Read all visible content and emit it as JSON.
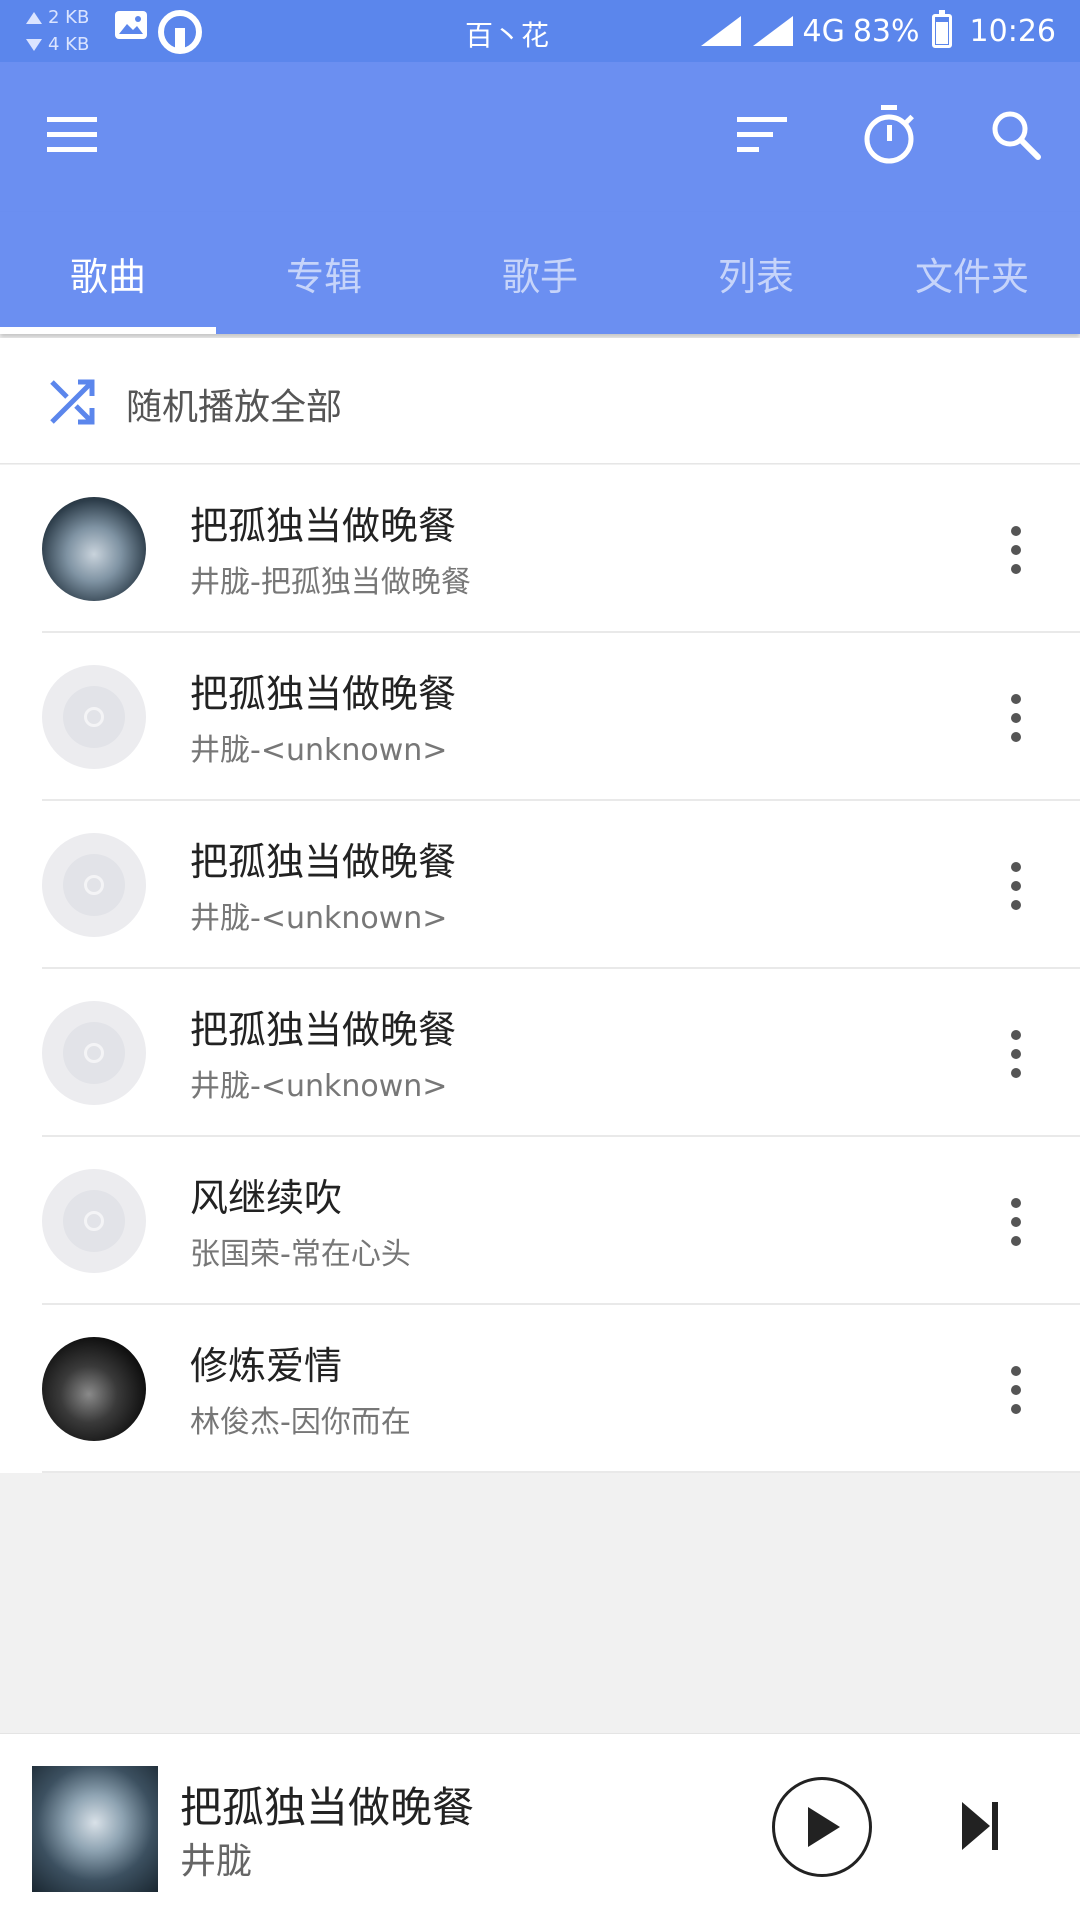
{
  "status_bar": {
    "speed_up": "2 KB",
    "speed_down": "4 KB",
    "center_text": "百丶花",
    "network": "4G",
    "battery": "83%",
    "time": "10:26"
  },
  "toolbar": {
    "menu_icon": "menu-icon",
    "sort_icon": "sort-icon",
    "timer_icon": "timer-icon",
    "search_icon": "search-icon"
  },
  "tabs": [
    {
      "label": "歌曲",
      "active": true
    },
    {
      "label": "专辑",
      "active": false
    },
    {
      "label": "歌手",
      "active": false
    },
    {
      "label": "列表",
      "active": false
    },
    {
      "label": "文件夹",
      "active": false
    }
  ],
  "shuffle": {
    "label": "随机播放全部"
  },
  "songs": [
    {
      "title": "把孤独当做晚餐",
      "subtitle": "井胧-把孤独当做晚餐",
      "cover": "art"
    },
    {
      "title": "把孤独当做晚餐",
      "subtitle": "井胧-<unknown>",
      "cover": "placeholder"
    },
    {
      "title": "把孤独当做晚餐",
      "subtitle": "井胧-<unknown>",
      "cover": "placeholder"
    },
    {
      "title": "把孤独当做晚餐",
      "subtitle": "井胧-<unknown>",
      "cover": "placeholder"
    },
    {
      "title": "风继续吹",
      "subtitle": "张国荣-常在心头",
      "cover": "placeholder"
    },
    {
      "title": "修炼爱情",
      "subtitle": "林俊杰-因你而在",
      "cover": "art"
    }
  ],
  "player": {
    "title": "把孤独当做晚餐",
    "artist": "井胧"
  },
  "colors": {
    "status_bar": "#5b86ec",
    "primary": "#6b8ff1",
    "shuffle_icon": "#5b86ec"
  }
}
